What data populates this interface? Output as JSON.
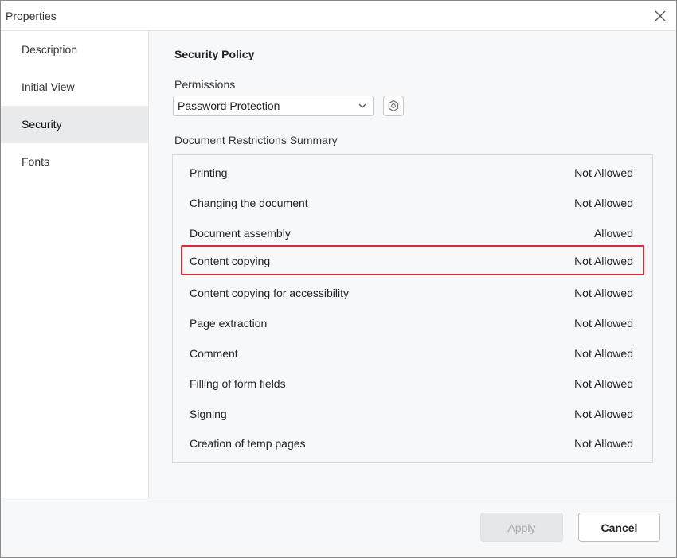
{
  "window": {
    "title": "Properties"
  },
  "sidebar": {
    "items": [
      {
        "label": "Description"
      },
      {
        "label": "Initial View"
      },
      {
        "label": "Security",
        "active": true
      },
      {
        "label": "Fonts"
      }
    ]
  },
  "main": {
    "section_title": "Security Policy",
    "permissions_label": "Permissions",
    "permissions_value": "Password Protection",
    "summary_label": "Document Restrictions Summary",
    "restrictions": [
      {
        "name": "Printing",
        "status": "Not Allowed"
      },
      {
        "name": "Changing the document",
        "status": "Not Allowed"
      },
      {
        "name": "Document assembly",
        "status": "Allowed"
      },
      {
        "name": "Content copying",
        "status": "Not Allowed",
        "highlighted": true
      },
      {
        "name": "Content copying for accessibility",
        "status": "Not Allowed"
      },
      {
        "name": "Page extraction",
        "status": "Not Allowed"
      },
      {
        "name": "Comment",
        "status": "Not Allowed"
      },
      {
        "name": "Filling of form fields",
        "status": "Not Allowed"
      },
      {
        "name": "Signing",
        "status": "Not Allowed"
      },
      {
        "name": "Creation of temp pages",
        "status": "Not Allowed"
      }
    ]
  },
  "footer": {
    "apply_label": "Apply",
    "cancel_label": "Cancel",
    "apply_enabled": false
  },
  "colors": {
    "highlight": "#d32f3a",
    "active_tab": "#e9eaec"
  },
  "icons": {
    "close": "close-icon",
    "dropdown": "chevron-down-icon",
    "settings": "gear-icon"
  }
}
